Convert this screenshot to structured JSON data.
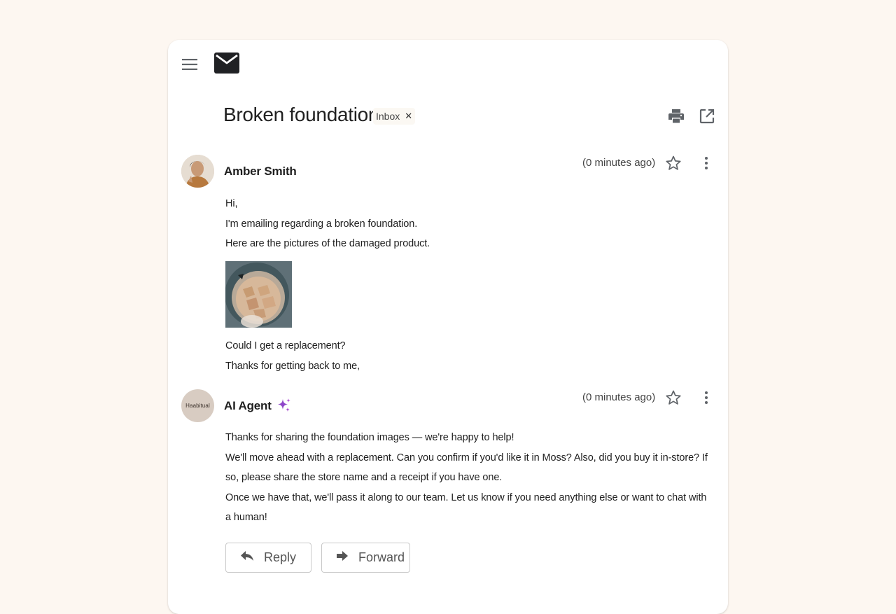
{
  "toolbar": {
    "menu_icon": "hamburger-menu-icon",
    "logo_icon": "envelope-icon"
  },
  "thread": {
    "subject": "Broken foundation",
    "label": "Inbox",
    "label_remove_icon": "close-icon",
    "actions": {
      "print_icon": "print-icon",
      "popout_icon": "open-in-new-icon"
    }
  },
  "messages": [
    {
      "sender": "Amber Smith",
      "timestamp": "(0 minutes ago)",
      "lines_before": [
        "Hi,",
        "I'm emailing regarding a broken foundation.",
        "Here are the pictures of the damaged product."
      ],
      "attachment_icon": "image-thumbnail",
      "lines_after": [
        "Could I get a replacement?",
        "Thanks for getting back to me,"
      ]
    },
    {
      "sender": "AI Agent",
      "avatar_text": "Haabitual",
      "sender_badge_icon": "sparkle-icon",
      "timestamp": "(0 minutes ago)",
      "lines": [
        "Thanks for sharing the foundation images — we're happy to help!",
        "We'll move ahead with a replacement. Can you confirm if you'd like it in Moss? Also, did you buy it in-store? If so, please share the store name and a receipt if you have one.",
        "Once we have that, we'll pass it along to our team. Let us know if you need anything else or want to chat with a human!"
      ]
    }
  ],
  "compose": {
    "reply_label": "Reply",
    "forward_label": "Forward"
  },
  "colors": {
    "page_bg": "#fdf7f1",
    "card_bg": "#ffffff",
    "sparkle": "#8e44c9"
  }
}
